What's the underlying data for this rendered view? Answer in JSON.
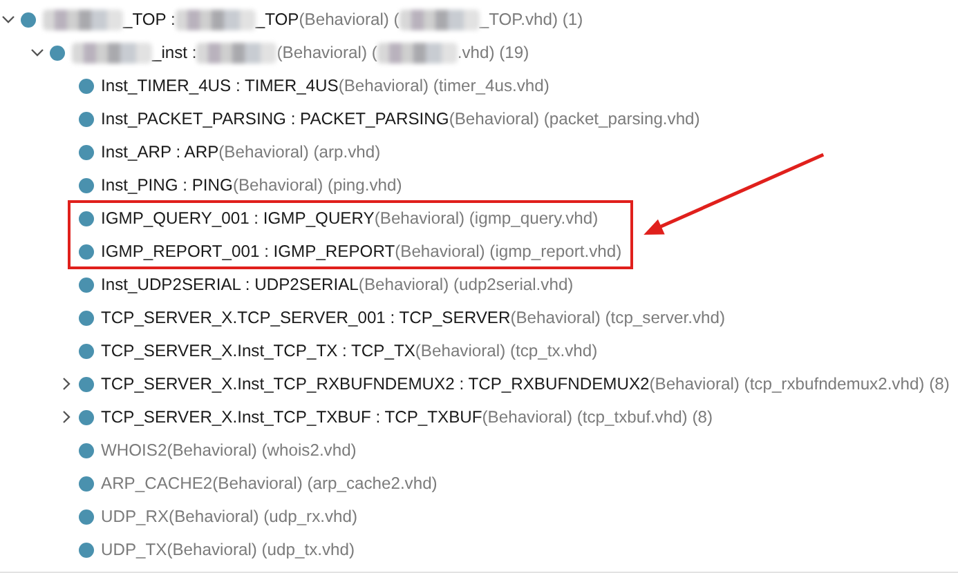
{
  "tree": [
    {
      "segments": [
        {
          "kind": "blur"
        },
        {
          "kind": "text",
          "muted": false,
          "text": "_TOP : "
        },
        {
          "kind": "blur"
        },
        {
          "kind": "text",
          "muted": false,
          "text": "_TOP"
        },
        {
          "kind": "text",
          "muted": true,
          "text": "(Behavioral) ("
        },
        {
          "kind": "blur"
        },
        {
          "kind": "text",
          "muted": true,
          "text": "_TOP.vhd) (1)"
        }
      ],
      "expanded": true,
      "children": [
        {
          "segments": [
            {
              "kind": "blur"
            },
            {
              "kind": "text",
              "muted": false,
              "text": "_inst : "
            },
            {
              "kind": "blur"
            },
            {
              "kind": "text",
              "muted": true,
              "text": "(Behavioral) ("
            },
            {
              "kind": "blur"
            },
            {
              "kind": "text",
              "muted": true,
              "text": ".vhd) (19)"
            }
          ],
          "expanded": true,
          "children": [
            {
              "segments": [
                {
                  "kind": "text",
                  "muted": false,
                  "text": "Inst_TIMER_4US : TIMER_4US"
                },
                {
                  "kind": "text",
                  "muted": true,
                  "text": "(Behavioral) (timer_4us.vhd)"
                }
              ],
              "boxed": false
            },
            {
              "segments": [
                {
                  "kind": "text",
                  "muted": false,
                  "text": "Inst_PACKET_PARSING : PACKET_PARSING"
                },
                {
                  "kind": "text",
                  "muted": true,
                  "text": "(Behavioral) (packet_parsing.vhd)"
                }
              ],
              "boxed": false
            },
            {
              "segments": [
                {
                  "kind": "text",
                  "muted": false,
                  "text": "Inst_ARP : ARP"
                },
                {
                  "kind": "text",
                  "muted": true,
                  "text": "(Behavioral) (arp.vhd)"
                }
              ],
              "boxed": false
            },
            {
              "segments": [
                {
                  "kind": "text",
                  "muted": false,
                  "text": "Inst_PING : PING"
                },
                {
                  "kind": "text",
                  "muted": true,
                  "text": "(Behavioral) (ping.vhd)"
                }
              ],
              "boxed": false
            },
            {
              "segments": [
                {
                  "kind": "text",
                  "muted": false,
                  "text": "IGMP_QUERY_001 : IGMP_QUERY"
                },
                {
                  "kind": "text",
                  "muted": true,
                  "text": "(Behavioral) (igmp_query.vhd)"
                }
              ],
              "boxed": true
            },
            {
              "segments": [
                {
                  "kind": "text",
                  "muted": false,
                  "text": "IGMP_REPORT_001 : IGMP_REPORT"
                },
                {
                  "kind": "text",
                  "muted": true,
                  "text": "(Behavioral) (igmp_report.vhd)"
                }
              ],
              "boxed": true
            },
            {
              "segments": [
                {
                  "kind": "text",
                  "muted": false,
                  "text": "Inst_UDP2SERIAL : UDP2SERIAL"
                },
                {
                  "kind": "text",
                  "muted": true,
                  "text": "(Behavioral) (udp2serial.vhd)"
                }
              ],
              "boxed": false
            },
            {
              "segments": [
                {
                  "kind": "text",
                  "muted": false,
                  "text": "TCP_SERVER_X.TCP_SERVER_001 : TCP_SERVER"
                },
                {
                  "kind": "text",
                  "muted": true,
                  "text": "(Behavioral) (tcp_server.vhd)"
                }
              ],
              "boxed": false
            },
            {
              "segments": [
                {
                  "kind": "text",
                  "muted": false,
                  "text": "TCP_SERVER_X.Inst_TCP_TX : TCP_TX"
                },
                {
                  "kind": "text",
                  "muted": true,
                  "text": "(Behavioral) (tcp_tx.vhd)"
                }
              ],
              "boxed": false
            },
            {
              "segments": [
                {
                  "kind": "text",
                  "muted": false,
                  "text": "TCP_SERVER_X.Inst_TCP_RXBUFNDEMUX2 : TCP_RXBUFNDEMUX2"
                },
                {
                  "kind": "text",
                  "muted": true,
                  "text": "(Behavioral) (tcp_rxbufndemux2.vhd) (8)"
                }
              ],
              "expanded": false,
              "boxed": false
            },
            {
              "segments": [
                {
                  "kind": "text",
                  "muted": false,
                  "text": "TCP_SERVER_X.Inst_TCP_TXBUF : TCP_TXBUF"
                },
                {
                  "kind": "text",
                  "muted": true,
                  "text": "(Behavioral) (tcp_txbuf.vhd) (8)"
                }
              ],
              "expanded": false,
              "boxed": false
            },
            {
              "segments": [
                {
                  "kind": "text",
                  "muted": true,
                  "text": "WHOIS2(Behavioral) (whois2.vhd)"
                }
              ],
              "boxed": false
            },
            {
              "segments": [
                {
                  "kind": "text",
                  "muted": true,
                  "text": "ARP_CACHE2(Behavioral) (arp_cache2.vhd)"
                }
              ],
              "boxed": false
            },
            {
              "segments": [
                {
                  "kind": "text",
                  "muted": true,
                  "text": "UDP_RX(Behavioral) (udp_rx.vhd)"
                }
              ],
              "boxed": false
            },
            {
              "segments": [
                {
                  "kind": "text",
                  "muted": true,
                  "text": "UDP_TX(Behavioral) (udp_tx.vhd)"
                }
              ],
              "boxed": false
            }
          ]
        }
      ]
    }
  ],
  "annotation": {
    "color": "#e0201c"
  }
}
